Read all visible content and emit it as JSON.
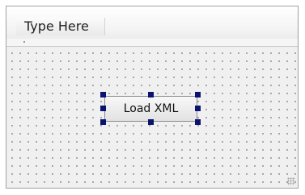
{
  "menubar": {
    "placeholder_item": "Type Here"
  },
  "form": {
    "button_label": "Load XML"
  },
  "colors": {
    "selection_handle": "#0a1470",
    "canvas": "#f0f0f0",
    "grid_dot": "#9a9a9a"
  },
  "icons": {
    "resize_grip": "resize-grip-icon"
  }
}
